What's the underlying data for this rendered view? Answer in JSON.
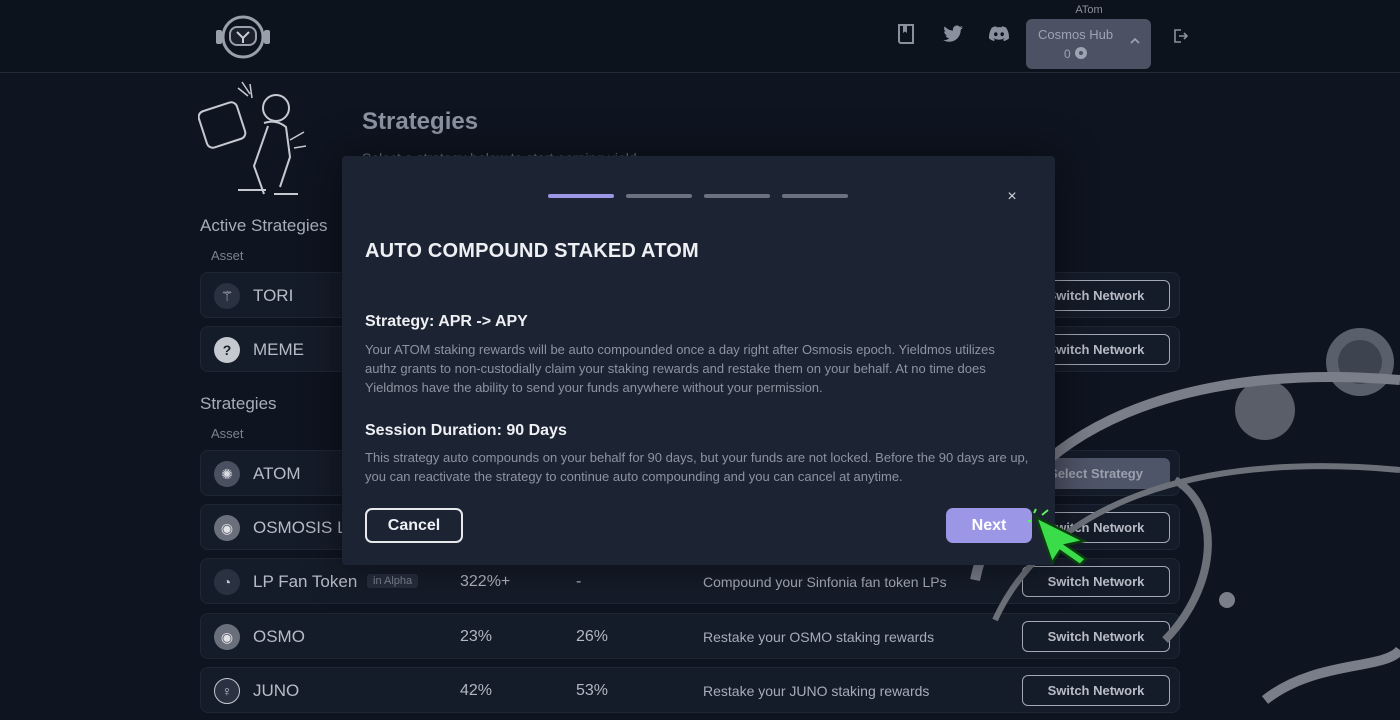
{
  "header": {
    "network_caption": "ATom",
    "network_name": "Cosmos Hub",
    "network_balance": "0"
  },
  "page": {
    "title": "Strategies",
    "subtitle": "Select a strategy below to start earning yield"
  },
  "active_strategies": {
    "title": "Active Strategies",
    "asset_header": "Asset",
    "rows": [
      {
        "name": "TORI",
        "action": "Switch Network"
      },
      {
        "name": "MEME",
        "action": "Switch Network"
      }
    ]
  },
  "strategies": {
    "title": "Strategies",
    "asset_header": "Asset",
    "rows": [
      {
        "name": "ATOM",
        "badge": "",
        "apr": "",
        "apy": "",
        "desc": "",
        "action": "Select Strategy"
      },
      {
        "name": "OSMOSIS LP",
        "badge": "",
        "apr": "",
        "apy": "",
        "desc": "",
        "action": "Switch Network"
      },
      {
        "name": "LP Fan Token",
        "badge": "in Alpha",
        "apr": "322%+",
        "apy": "-",
        "desc": "Compound your Sinfonia fan token LPs",
        "action": "Switch Network"
      },
      {
        "name": "OSMO",
        "badge": "",
        "apr": "23%",
        "apy": "26%",
        "desc": "Restake your OSMO staking rewards",
        "action": "Switch Network"
      },
      {
        "name": "JUNO",
        "badge": "",
        "apr": "42%",
        "apy": "53%",
        "desc": "Restake your JUNO staking rewards",
        "action": "Switch Network"
      }
    ]
  },
  "modal": {
    "title": "AUTO COMPOUND STAKED ATOM",
    "close_label": "×",
    "section1_title": "Strategy: APR -> APY",
    "section1_text": "Your ATOM staking rewards will be auto compounded once a day right after Osmosis epoch. Yieldmos utilizes authz grants to non-custodially claim your staking rewards and restake them on your behalf. At no time does Yieldmos have the ability to send your funds anywhere without your permission.",
    "section2_title": "Session Duration: 90 Days",
    "section2_text": "This strategy auto compounds on your behalf for 90 days, but your funds are not locked. Before the 90 days are up, you can reactivate the strategy to continue auto compounding and you can cancel at anytime.",
    "cancel_label": "Cancel",
    "next_label": "Next",
    "steps_total": 4,
    "step_current": 1
  },
  "colors": {
    "accent": "#9b97e6",
    "background": "#0e1420",
    "modal": "#1c2434"
  }
}
